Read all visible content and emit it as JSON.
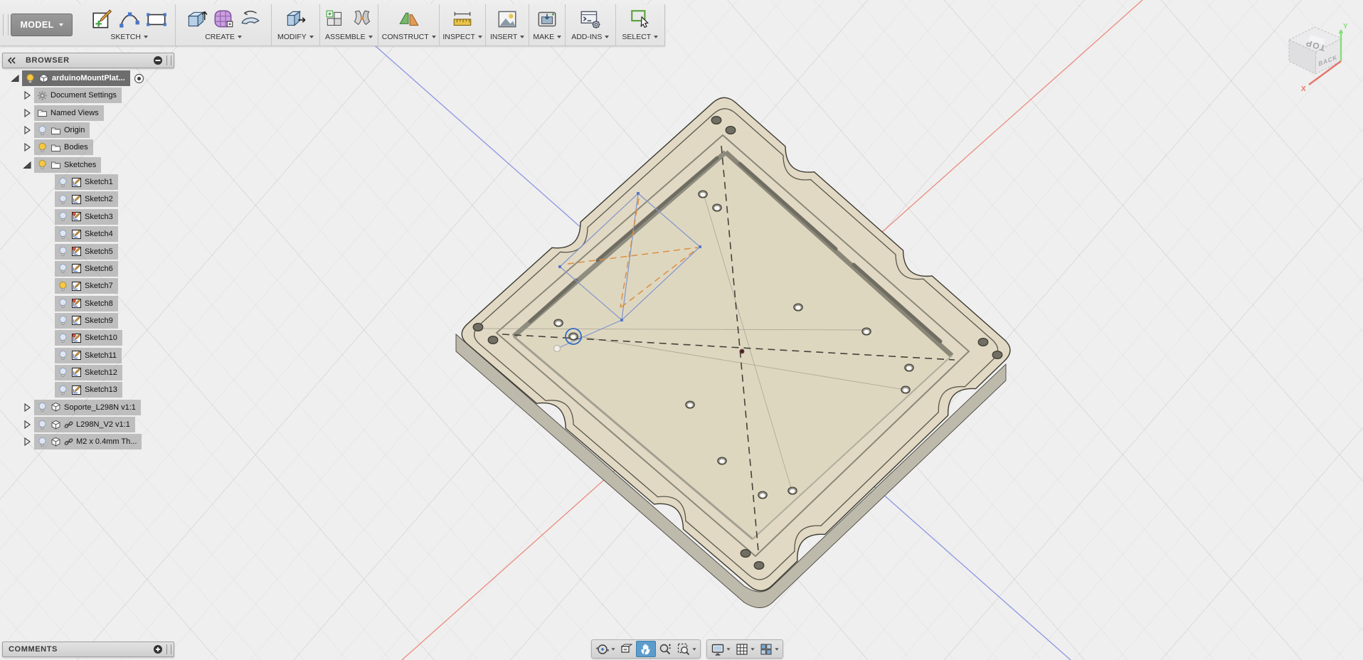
{
  "app": {
    "workspace_label": "MODEL"
  },
  "toolbar": {
    "groups": [
      {
        "label": "SKETCH",
        "icons": [
          "create-sketch-icon",
          "spline-icon",
          "rectangle-icon"
        ]
      },
      {
        "label": "CREATE",
        "icons": [
          "extrude-icon",
          "form-icon",
          "revolve-icon"
        ]
      },
      {
        "label": "MODIFY",
        "icons": [
          "press-pull-icon"
        ]
      },
      {
        "label": "ASSEMBLE",
        "icons": [
          "new-component-icon",
          "joint-icon"
        ]
      },
      {
        "label": "CONSTRUCT",
        "icons": [
          "construction-plane-icon"
        ]
      },
      {
        "label": "INSPECT",
        "icons": [
          "measure-icon"
        ]
      },
      {
        "label": "INSERT",
        "icons": [
          "insert-image-icon"
        ]
      },
      {
        "label": "MAKE",
        "icons": [
          "print-3d-icon"
        ]
      },
      {
        "label": "ADD-INS",
        "icons": [
          "scripts-addins-icon"
        ]
      },
      {
        "label": "SELECT",
        "icons": [
          "select-icon"
        ]
      }
    ]
  },
  "browser": {
    "title": "BROWSER",
    "items": [
      {
        "label": "arduinoMountPlat...",
        "icon": "component",
        "bulb": "on",
        "expander": "expanded",
        "indent": 0,
        "selected": true,
        "radio": true
      },
      {
        "label": "Document Settings",
        "icon": "gear",
        "bulb": "none",
        "expander": "collapsed",
        "indent": 1
      },
      {
        "label": "Named Views",
        "icon": "folder",
        "bulb": "none",
        "expander": "collapsed",
        "indent": 1
      },
      {
        "label": "Origin",
        "icon": "folder",
        "bulb": "off",
        "expander": "collapsed",
        "indent": 1
      },
      {
        "label": "Bodies",
        "icon": "folder",
        "bulb": "on",
        "expander": "collapsed",
        "indent": 1
      },
      {
        "label": "Sketches",
        "icon": "folder",
        "bulb": "on",
        "expander": "expanded",
        "indent": 1
      },
      {
        "label": "Sketch1",
        "icon": "sketch",
        "bulb": "off",
        "expander": "none",
        "indent": 2
      },
      {
        "label": "Sketch2",
        "icon": "sketch",
        "bulb": "off",
        "expander": "none",
        "indent": 2
      },
      {
        "label": "Sketch3",
        "icon": "sketch-pinned",
        "bulb": "off",
        "expander": "none",
        "indent": 2
      },
      {
        "label": "Sketch4",
        "icon": "sketch",
        "bulb": "off",
        "expander": "none",
        "indent": 2
      },
      {
        "label": "Sketch5",
        "icon": "sketch-pinned",
        "bulb": "off",
        "expander": "none",
        "indent": 2
      },
      {
        "label": "Sketch6",
        "icon": "sketch",
        "bulb": "off",
        "expander": "none",
        "indent": 2
      },
      {
        "label": "Sketch7",
        "icon": "sketch",
        "bulb": "on",
        "expander": "none",
        "indent": 2
      },
      {
        "label": "Sketch8",
        "icon": "sketch-pinned",
        "bulb": "off",
        "expander": "none",
        "indent": 2
      },
      {
        "label": "Sketch9",
        "icon": "sketch",
        "bulb": "off",
        "expander": "none",
        "indent": 2
      },
      {
        "label": "Sketch10",
        "icon": "sketch-pinned",
        "bulb": "off",
        "expander": "none",
        "indent": 2
      },
      {
        "label": "Sketch11",
        "icon": "sketch",
        "bulb": "off",
        "expander": "none",
        "indent": 2
      },
      {
        "label": "Sketch12",
        "icon": "sketch",
        "bulb": "off",
        "expander": "none",
        "indent": 2
      },
      {
        "label": "Sketch13",
        "icon": "sketch",
        "bulb": "off",
        "expander": "none",
        "indent": 2
      },
      {
        "label": "Soporte_L298N v1:1",
        "icon": "component",
        "bulb": "off",
        "expander": "collapsed",
        "indent": 1
      },
      {
        "label": "L298N_V2 v1:1",
        "icon": "component",
        "bulb": "off",
        "expander": "collapsed",
        "indent": 1,
        "link": true
      },
      {
        "label": "M2 x 0.4mm Th...",
        "icon": "component",
        "bulb": "off",
        "expander": "collapsed",
        "indent": 1,
        "link": true
      }
    ]
  },
  "comments": {
    "title": "COMMENTS"
  },
  "navbar": {
    "active_tool": "pan",
    "icons": [
      "orbit-icon",
      "look-at-icon",
      "pan-icon",
      "zoom-icon",
      "zoom-window-icon",
      "display-settings-icon",
      "grid-snap-icon",
      "viewports-icon"
    ]
  },
  "viewcube": {
    "faces": {
      "top": "TOP",
      "back": "BACK"
    },
    "axes": {
      "x": "X",
      "y": "Y"
    }
  },
  "colors": {
    "pan_active": "#5b9ccc",
    "part_top": "#e1d9c3",
    "axis_red": "#eb8b7f",
    "axis_blue": "#8d96e2",
    "sketch_blue": "#8194cc",
    "construction_orange": "#dd8f3f",
    "bulb_on": "#f6c844",
    "bulb_off": "#dfe6f2"
  }
}
